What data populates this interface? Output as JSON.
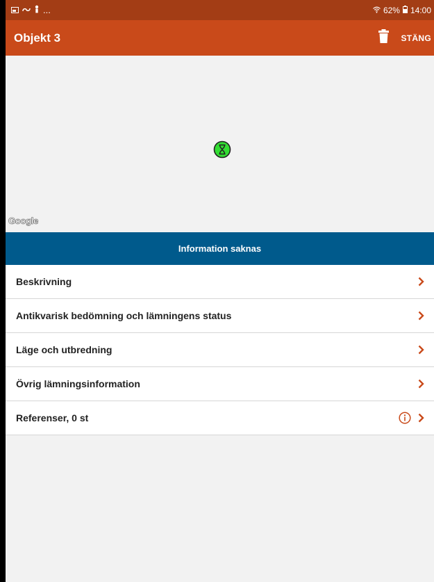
{
  "status_bar": {
    "left_more": "...",
    "battery": "62%",
    "time": "14:00"
  },
  "toolbar": {
    "title": "Objekt 3",
    "close_label": "STÄNG"
  },
  "map": {
    "attribution": "Google"
  },
  "banner": {
    "text": "Information saknas"
  },
  "list": {
    "items": [
      {
        "label": "Beskrivning"
      },
      {
        "label": "Antikvarisk bedömning och lämningens status"
      },
      {
        "label": "Läge och utbredning"
      },
      {
        "label": "Övrig lämningsinformation"
      },
      {
        "label": "Referenser, 0 st"
      }
    ]
  },
  "colors": {
    "status_bar": "#a33d15",
    "toolbar": "#c94a1a",
    "banner": "#005a8c",
    "chevron": "#c94a1a",
    "marker_fill": "#33dd33"
  }
}
